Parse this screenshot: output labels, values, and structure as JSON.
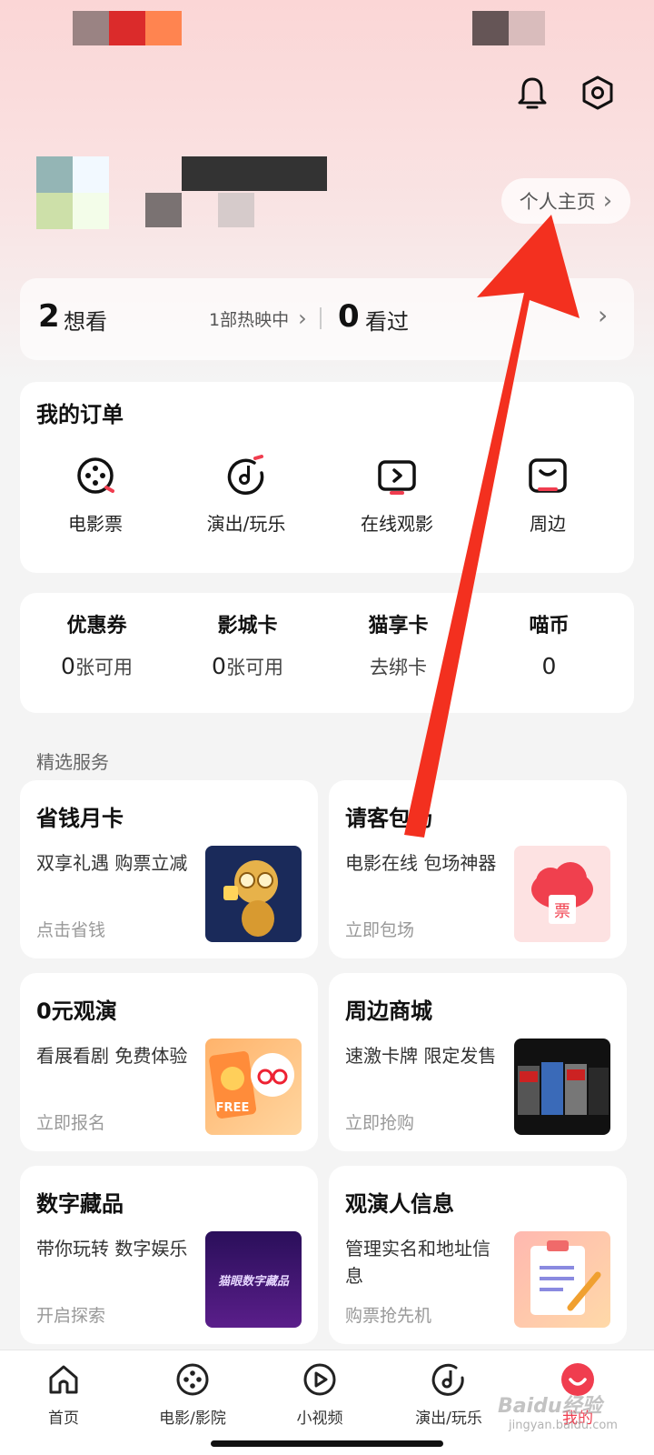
{
  "header": {
    "personal_home_label": "个人主页",
    "chevron": "›"
  },
  "stats": {
    "want_count": "2",
    "want_label": "想看",
    "hot_text": "1部热映中",
    "watched_count": "0",
    "watched_label": "看过"
  },
  "orders": {
    "title": "我的订单",
    "items": [
      {
        "label": "电影票",
        "icon": "film-reel-icon"
      },
      {
        "label": "演出/玩乐",
        "icon": "music-note-icon"
      },
      {
        "label": "在线观影",
        "icon": "play-screen-icon"
      },
      {
        "label": "周边",
        "icon": "shopping-bag-icon"
      }
    ]
  },
  "wallet": [
    {
      "title": "优惠券",
      "num": "0",
      "unit": "张可用"
    },
    {
      "title": "影城卡",
      "num": "0",
      "unit": "张可用"
    },
    {
      "title": "猫享卡",
      "num": "",
      "unit": "去绑卡"
    },
    {
      "title": "喵币",
      "num": "0",
      "unit": ""
    }
  ],
  "services": {
    "heading": "精选服务",
    "items": [
      {
        "title": "省钱月卡",
        "desc": "双享礼遇 购票立减",
        "action": "点击省钱"
      },
      {
        "title": "请客包场",
        "desc": "电影在线 包场神器",
        "action": "立即包场"
      },
      {
        "title": "0元观演",
        "desc": "看展看剧 免费体验",
        "action": "立即报名"
      },
      {
        "title": "周边商城",
        "desc": "速激卡牌 限定发售",
        "action": "立即抢购"
      },
      {
        "title": "数字藏品",
        "desc": "带你玩转 数字娱乐",
        "action": "开启探索"
      },
      {
        "title": "观演人信息",
        "desc": "管理实名和地址信息",
        "action": "购票抢先机"
      }
    ],
    "thumb_texts": {
      "ticket": "票",
      "free": "FREE",
      "digital": "猫眼数字藏品"
    }
  },
  "tabbar": [
    {
      "label": "首页",
      "icon": "home-icon"
    },
    {
      "label": "电影/影院",
      "icon": "film-reel-icon"
    },
    {
      "label": "小视频",
      "icon": "play-circle-icon"
    },
    {
      "label": "演出/玩乐",
      "icon": "music-note-icon"
    },
    {
      "label": "我的",
      "icon": "profile-icon",
      "active": true
    }
  ],
  "colors": {
    "accent": "#f03d4f",
    "arrow": "#f3301f"
  },
  "watermark": {
    "main": "Baidu经验",
    "sub": "jingyan.baidu.com"
  }
}
